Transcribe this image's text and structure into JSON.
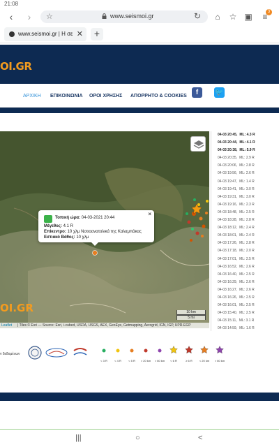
{
  "statusbar": {
    "time": "21:08"
  },
  "browser": {
    "url": "www.seismoi.gr",
    "tab_title": "www.seismoi.gr | Η σε...",
    "tab_count": "3"
  },
  "site": {
    "logo_text": "OI.GR",
    "map_logo_text": "OI.GR",
    "nav": [
      "ΑΡΧΙΚΗ",
      "ΕΠΙΚΟΙΝΩΝΙΑ",
      "ΟΡΟΙ ΧΡΗΣΗΣ",
      "ΑΠΟΡΡΗΤΟ & COOKIES"
    ]
  },
  "popup": {
    "time_label": "Τοπική ώρα:",
    "time_value": "04-03-2021 20:44",
    "magnitude_label": "Μέγεθος:",
    "magnitude_value": "4.1 R",
    "epicenter_label": "Επίκεντρο:",
    "epicenter_value": "10 χλμ Νοτιοανατολικά της Καλαμπάκας",
    "depth_label": "Εστιακό Βάθος:",
    "depth_value": "10 χλμ",
    "close": "×"
  },
  "map": {
    "scale_km": "10 km",
    "scale_mi": "5 mi",
    "leaflet": "Leaflet",
    "attribution": "| Tiles © Esri — Source: Esri, i-cubed, USDA, USGS, AEX, GeoEye, Getmapping, Aerogrid, IGN, IGP, UPR-EGP"
  },
  "events": [
    {
      "t": "04-03 20:45,",
      "m": "ML: 4.3 R",
      "bold": true
    },
    {
      "t": "04-03 20:44,",
      "m": "ML: 4.1 R",
      "bold": true
    },
    {
      "t": "04-03 20:38,",
      "m": "ML: 5.9 R",
      "bold": true
    },
    {
      "t": "04-03 20:35,",
      "m": "ML: 2.9 R",
      "bold": false
    },
    {
      "t": "04-03 20:06,",
      "m": "ML: 2.8 R",
      "bold": false
    },
    {
      "t": "04-03 19:56,",
      "m": "ML: 2.6 R",
      "bold": false
    },
    {
      "t": "04-03 19:47,",
      "m": "ML: 1.4 R",
      "bold": false
    },
    {
      "t": "04-03 19:41,",
      "m": "ML: 3.0 R",
      "bold": false
    },
    {
      "t": "04-03 19:31,",
      "m": "ML: 3.0 R",
      "bold": false
    },
    {
      "t": "04-03 19:16,",
      "m": "ML: 2.3 R",
      "bold": false
    },
    {
      "t": "04-03 18:48,",
      "m": "ML: 2.5 R",
      "bold": false
    },
    {
      "t": "04-03 18:28,",
      "m": "ML: 2.8 R",
      "bold": false
    },
    {
      "t": "04-03 18:12,",
      "m": "ML: 2.4 R",
      "bold": false
    },
    {
      "t": "04-03 18:01,",
      "m": "ML: 2.4 R",
      "bold": false
    },
    {
      "t": "04-03 17:26,",
      "m": "ML: 2.8 R",
      "bold": false
    },
    {
      "t": "04-03 17:18,",
      "m": "ML: 2.0 R",
      "bold": false
    },
    {
      "t": "04-03 17:01,",
      "m": "ML: 2.5 R",
      "bold": false
    },
    {
      "t": "04-03 16:52,",
      "m": "ML: 2.6 R",
      "bold": false
    },
    {
      "t": "04-03 16:40,",
      "m": "ML: 2.5 R",
      "bold": false
    },
    {
      "t": "04-03 16:29,",
      "m": "ML: 2.6 R",
      "bold": false
    },
    {
      "t": "04-03 16:27,",
      "m": "ML: 2.6 R",
      "bold": false
    },
    {
      "t": "04-03 16:26,",
      "m": "ML: 2.5 R",
      "bold": false
    },
    {
      "t": "04-03 16:01,",
      "m": "ML: 2.5 R",
      "bold": false
    },
    {
      "t": "04-03 15:40,",
      "m": "ML: 2.5 R",
      "bold": false
    },
    {
      "t": "04-03 15:11,",
      "m": "ML: 3.1 R",
      "bold": false
    },
    {
      "t": "04-03 14:59,",
      "m": "ML: 1.6 R",
      "bold": false
    },
    {
      "t": "04-03 14:46,",
      "m": "ML: 2.5 R",
      "bold": false
    }
  ],
  "footer": {
    "data_text": "ν δεδομένων",
    "legend": [
      "< 3 R",
      "< 4 R",
      "< 5 R",
      "> 20 km",
      "> 60 km",
      "< 6 R",
      "≥ 6 R",
      "< 20 km",
      "> 60 km"
    ],
    "colors": {
      "header": "#0d2a52",
      "accent": "#f29b1f",
      "facebook": "#3b5998",
      "twitter": "#1da1f2"
    }
  },
  "sysnav": {
    "recent": "|||",
    "home": "○",
    "back": "<"
  }
}
